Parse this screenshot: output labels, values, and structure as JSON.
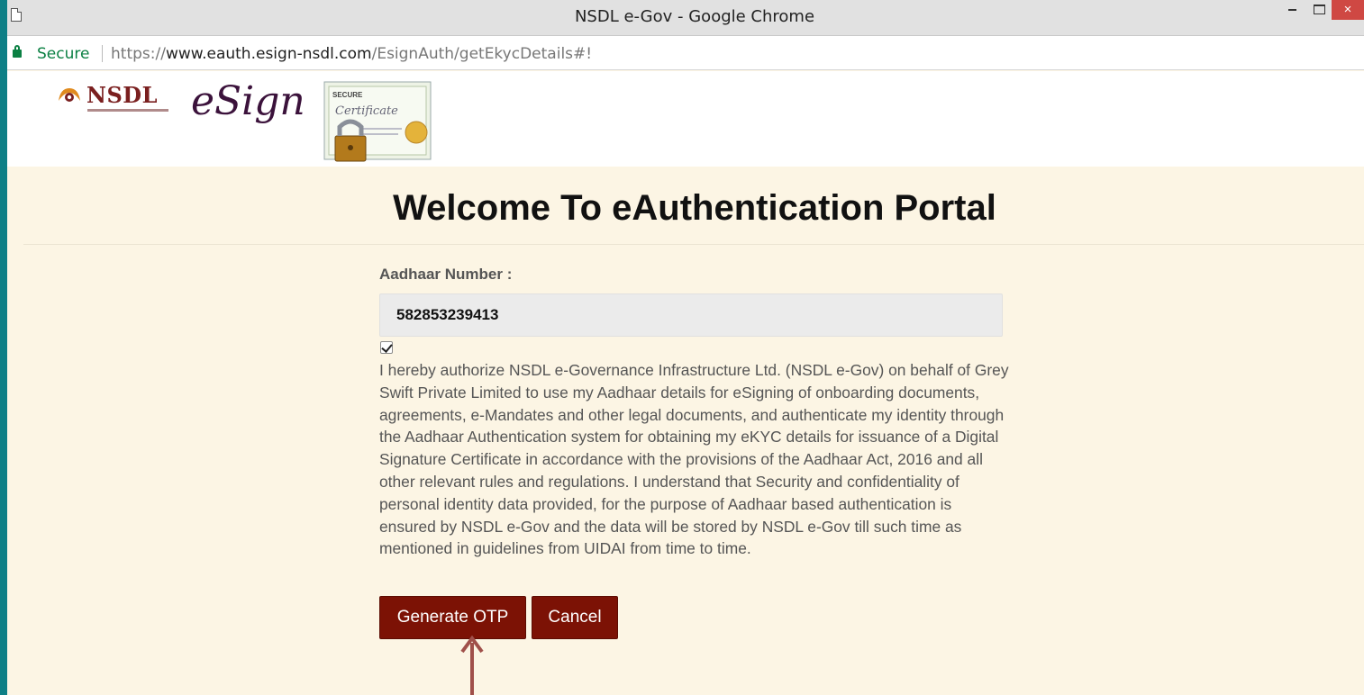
{
  "window": {
    "title": "NSDL e-Gov - Google Chrome",
    "close_glyph": "×"
  },
  "addressbar": {
    "secure_label": "Secure",
    "url_scheme": "https://",
    "url_host": "www.eauth.esign-nsdl.com",
    "url_path": "/EsignAuth/getEkycDetails#!"
  },
  "header": {
    "nsdl_logo_text": "NSDL",
    "esign_logo_text": "eSign",
    "certificate_image_text": [
      "SECURE",
      "Certificate"
    ]
  },
  "main": {
    "title": "Welcome To eAuthentication Portal",
    "aadhaar_label": "Aadhaar Number :",
    "aadhaar_value": "582853239413",
    "consent_checked": true,
    "consent_text": "I hereby authorize NSDL e-Governance Infrastructure Ltd. (NSDL e-Gov) on behalf of Grey Swift Private Limited to use my Aadhaar details for eSigning of onboarding documents, agreements, e-Mandates and other legal documents, and authenticate my identity through the Aadhaar Authentication system for obtaining my eKYC details for issuance of a Digital Signature Certificate in accordance with the provisions of the Aadhaar Act, 2016 and all other relevant rules and regulations. I understand that Security and confidentiality of personal identity data provided, for the purpose of Aadhaar based authentication is ensured by NSDL e-Gov and the data will be stored by NSDL e-Gov till such time as mentioned in guidelines from UIDAI from time to time.",
    "generate_otp_label": "Generate OTP",
    "cancel_label": "Cancel"
  },
  "colors": {
    "button_bg": "#7c1205",
    "page_bg": "#fcf5e4",
    "frame_bg": "#0e7f86",
    "secure_green": "#0b8043",
    "close_red": "#cf4843"
  },
  "icons": [
    "page-icon",
    "lock-icon",
    "minimize-icon",
    "maximize-icon",
    "close-icon",
    "pointer-arrow-icon"
  ]
}
